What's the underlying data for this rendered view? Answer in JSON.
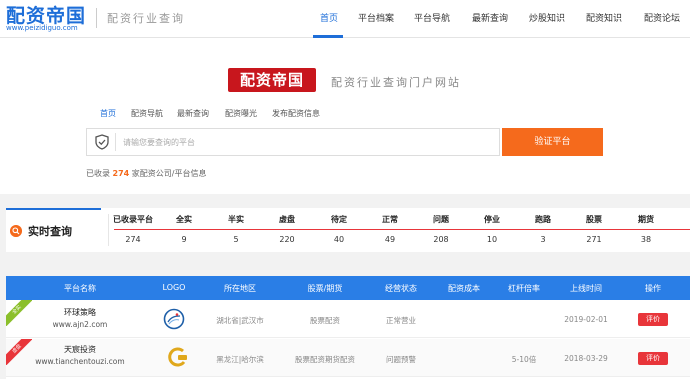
{
  "header": {
    "logo_text": "配资帝国",
    "logo_url": "www.peizidiguo.com",
    "slogan": "配资行业查询",
    "nav": [
      "首页",
      "平台档案",
      "平台导航",
      "最新查询",
      "炒股知识",
      "配资知识",
      "配资论坛"
    ],
    "nav_active": 0
  },
  "hero": {
    "logo_text": "配资帝国",
    "slogan": "配资行业查询门户网站",
    "subnav": [
      "首页",
      "配资导航",
      "最新查询",
      "配资曝光",
      "发布配资信息"
    ],
    "search_placeholder": "请输您要查询的平台",
    "search_button": "验证平台",
    "count_prefix": "已收录",
    "count_value": "274",
    "count_suffix": "家配资公司/平台信息"
  },
  "stats": {
    "title": "实时查询",
    "headers": [
      "已收录平台",
      "全实",
      "半实",
      "虚盘",
      "待定",
      "正常",
      "问题",
      "停业",
      "跑路",
      "股票",
      "期货"
    ],
    "values": [
      "274",
      "9",
      "5",
      "220",
      "40",
      "49",
      "208",
      "10",
      "3",
      "271",
      "38"
    ]
  },
  "table": {
    "headers": [
      "平台名称",
      "LOGO",
      "所在地区",
      "股票/期货",
      "经营状态",
      "配资成本",
      "杠杆倍率",
      "上线时间",
      "操作"
    ],
    "rows": [
      {
        "ribbon": "全实",
        "ribbon_color": "#8bbf2b",
        "name": "环球策略",
        "url": "www.ajn2.com",
        "logo_icon": "globe-logo-icon",
        "region": "湖北省|武汉市",
        "type": "股票配资",
        "status": "正常营业",
        "cost": "",
        "leverage": "",
        "date": "2019-02-01",
        "action": "评价"
      },
      {
        "ribbon": "虚盘",
        "ribbon_color": "#e8353a",
        "name": "天宸投资",
        "url": "www.tianchentouzi.com",
        "logo_icon": "gold-logo-icon",
        "region": "黑龙江|哈尔滨",
        "type": "股票配资期货配资",
        "status": "问题预警",
        "cost": "",
        "leverage": "5-10倍",
        "date": "2018-03-29",
        "action": "评价"
      }
    ]
  }
}
